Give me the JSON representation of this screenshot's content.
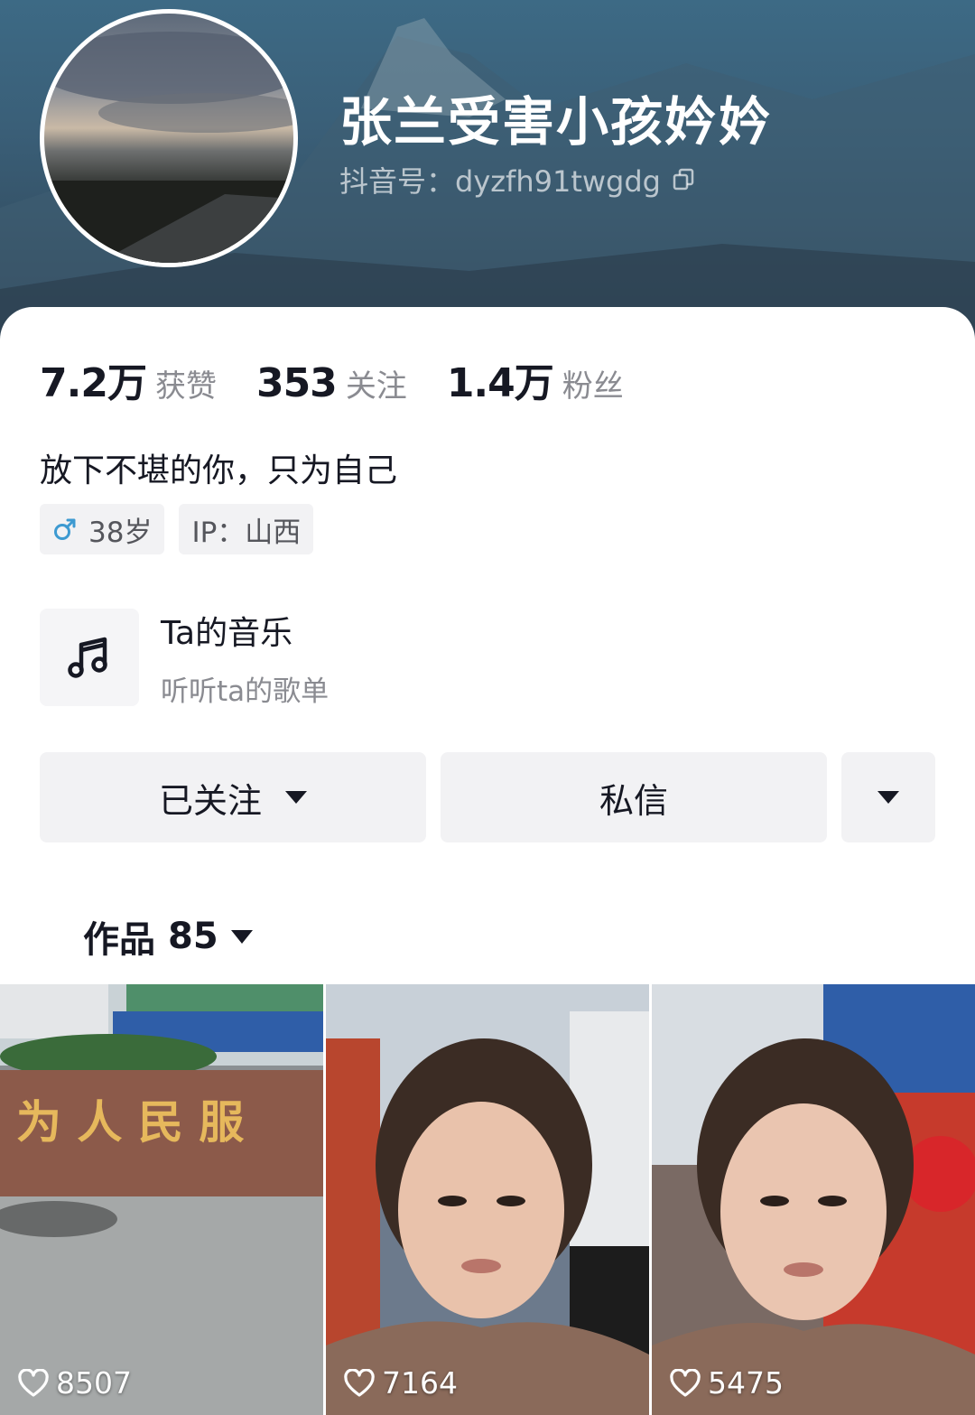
{
  "profile": {
    "nickname": "张兰受害小孩妗妗",
    "douyin_id": "抖音号：dyzfh91twgdg",
    "bio": "放下不堪的你，只为自己",
    "tags": {
      "gender_age": "38岁",
      "ip": "IP：山西"
    }
  },
  "stats": {
    "likes": {
      "value": "7.2万",
      "label": "获赞"
    },
    "following": {
      "value": "353",
      "label": "关注"
    },
    "followers": {
      "value": "1.4万",
      "label": "粉丝"
    }
  },
  "music": {
    "title": "Ta的音乐",
    "subtitle": "听听ta的歌单"
  },
  "actions": {
    "follow_label": "已关注",
    "message_label": "私信"
  },
  "works": {
    "label": "作品",
    "count": "85"
  },
  "videos": [
    {
      "likes": "8507"
    },
    {
      "likes": "7164"
    },
    {
      "likes": "5475"
    }
  ],
  "colors": {
    "header_bg": "#3a5f78",
    "button_bg": "#f2f2f4",
    "text_secondary": "#8a8b91"
  }
}
